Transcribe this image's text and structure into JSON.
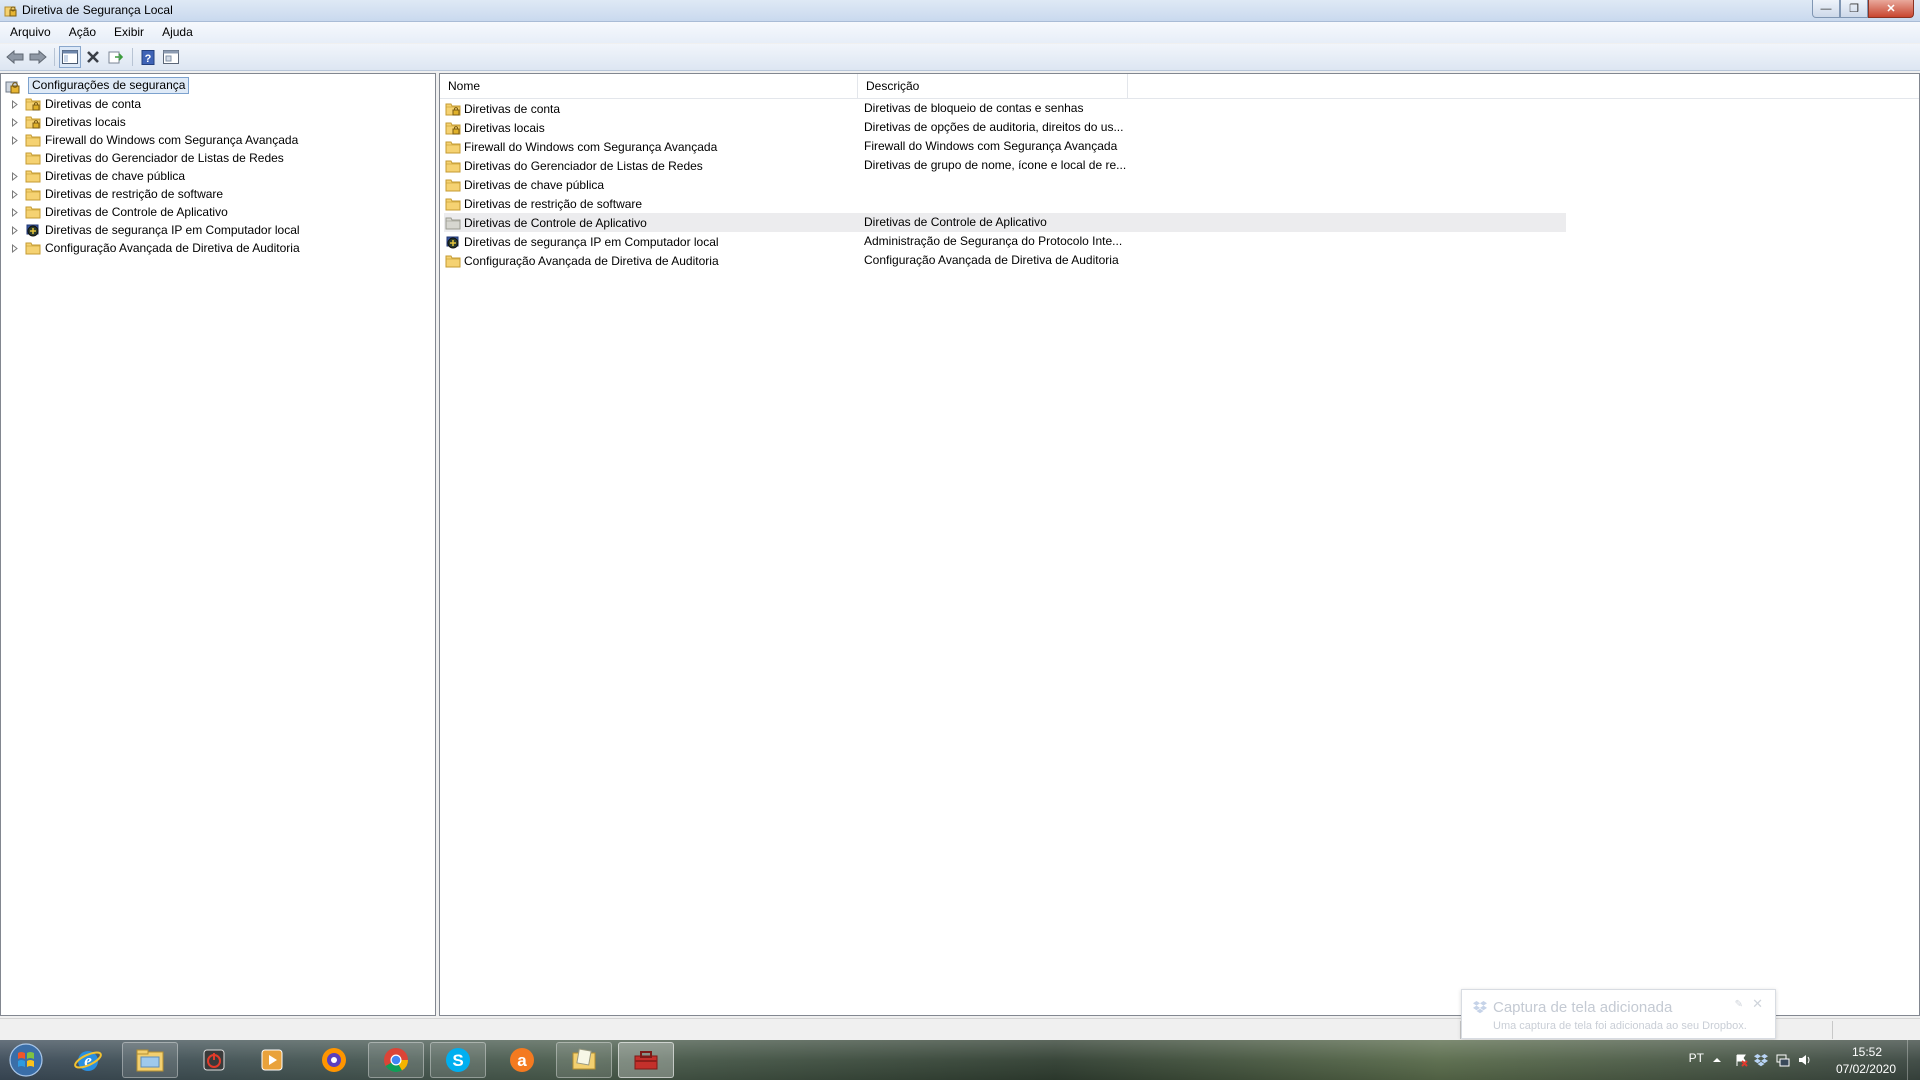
{
  "window": {
    "title": "Diretiva de Segurança Local",
    "minimize_symbol": "—",
    "maximize_symbol": "❐",
    "close_symbol": "✕"
  },
  "menu": [
    "Arquivo",
    "Ação",
    "Exibir",
    "Ajuda"
  ],
  "toolbar": {
    "icons": [
      "back-arrow-icon",
      "forward-arrow-icon",
      "show-hide-console-tree-icon",
      "delete-icon",
      "export-list-icon",
      "help-icon",
      "properties-pane-icon"
    ]
  },
  "tree": {
    "root": "Configurações de segurança",
    "items": [
      {
        "label": "Diretivas de conta",
        "icon": "folder-lock-icon",
        "expandable": true
      },
      {
        "label": "Diretivas locais",
        "icon": "folder-lock-icon",
        "expandable": true
      },
      {
        "label": "Firewall do Windows com Segurança Avançada",
        "icon": "folder-icon",
        "expandable": true
      },
      {
        "label": "Diretivas do Gerenciador de Listas de Redes",
        "icon": "folder-icon",
        "expandable": false
      },
      {
        "label": "Diretivas de chave pública",
        "icon": "folder-icon",
        "expandable": true
      },
      {
        "label": "Diretivas de restrição de software",
        "icon": "folder-icon",
        "expandable": true
      },
      {
        "label": "Diretivas de Controle de Aplicativo",
        "icon": "folder-icon",
        "expandable": true
      },
      {
        "label": "Diretivas de segurança IP em Computador local",
        "icon": "ip-security-icon",
        "expandable": true
      },
      {
        "label": "Configuração Avançada de Diretiva de Auditoria",
        "icon": "folder-icon",
        "expandable": true
      }
    ]
  },
  "list": {
    "columns": [
      "Nome",
      "Descrição"
    ],
    "rows": [
      {
        "name": "Diretivas de conta",
        "description": "Diretivas de bloqueio de contas e senhas",
        "icon": "folder-lock-icon"
      },
      {
        "name": "Diretivas locais",
        "description": "Diretivas de opções de auditoria, direitos do us...",
        "icon": "folder-lock-icon"
      },
      {
        "name": "Firewall do Windows com Segurança Avançada",
        "description": "Firewall do Windows com Segurança Avançada",
        "icon": "folder-icon"
      },
      {
        "name": "Diretivas do Gerenciador de Listas de Redes",
        "description": "Diretivas de grupo de nome, ícone e local de re...",
        "icon": "folder-icon"
      },
      {
        "name": "Diretivas de chave pública",
        "description": "",
        "icon": "folder-icon"
      },
      {
        "name": "Diretivas de restrição de software",
        "description": "",
        "icon": "folder-icon"
      },
      {
        "name": "Diretivas de Controle de Aplicativo",
        "description": "Diretivas de Controle de Aplicativo",
        "icon": "folder-gray-icon",
        "highlighted": true
      },
      {
        "name": "Diretivas de segurança IP em Computador local",
        "description": "Administração de Segurança do Protocolo Inte...",
        "icon": "ip-security-icon"
      },
      {
        "name": "Configuração Avançada de Diretiva de Auditoria",
        "description": "Configuração Avançada de Diretiva de Auditoria",
        "icon": "folder-icon"
      }
    ]
  },
  "notification": {
    "title": "Captura de tela adicionada",
    "body": "Uma captura de tela foi adicionada ao seu Dropbox.",
    "icon": "dropbox-icon"
  },
  "taskbar": {
    "apps": [
      "start-orb-icon",
      "internet-explorer-icon",
      "windows-explorer-icon",
      "power-shutdown-icon",
      "media-player-icon",
      "firefox-icon",
      "chrome-icon",
      "skype-icon",
      "avast-icon",
      "folder-notes-icon",
      "toolbox-icon"
    ],
    "language": "PT",
    "time": "15:52",
    "date": "07/02/2020"
  },
  "colors": {
    "selection_border": "#7da2ce",
    "selection_bg": "#dfeaf7",
    "folder": "#f5d272",
    "row_highlight": "#ececee"
  }
}
